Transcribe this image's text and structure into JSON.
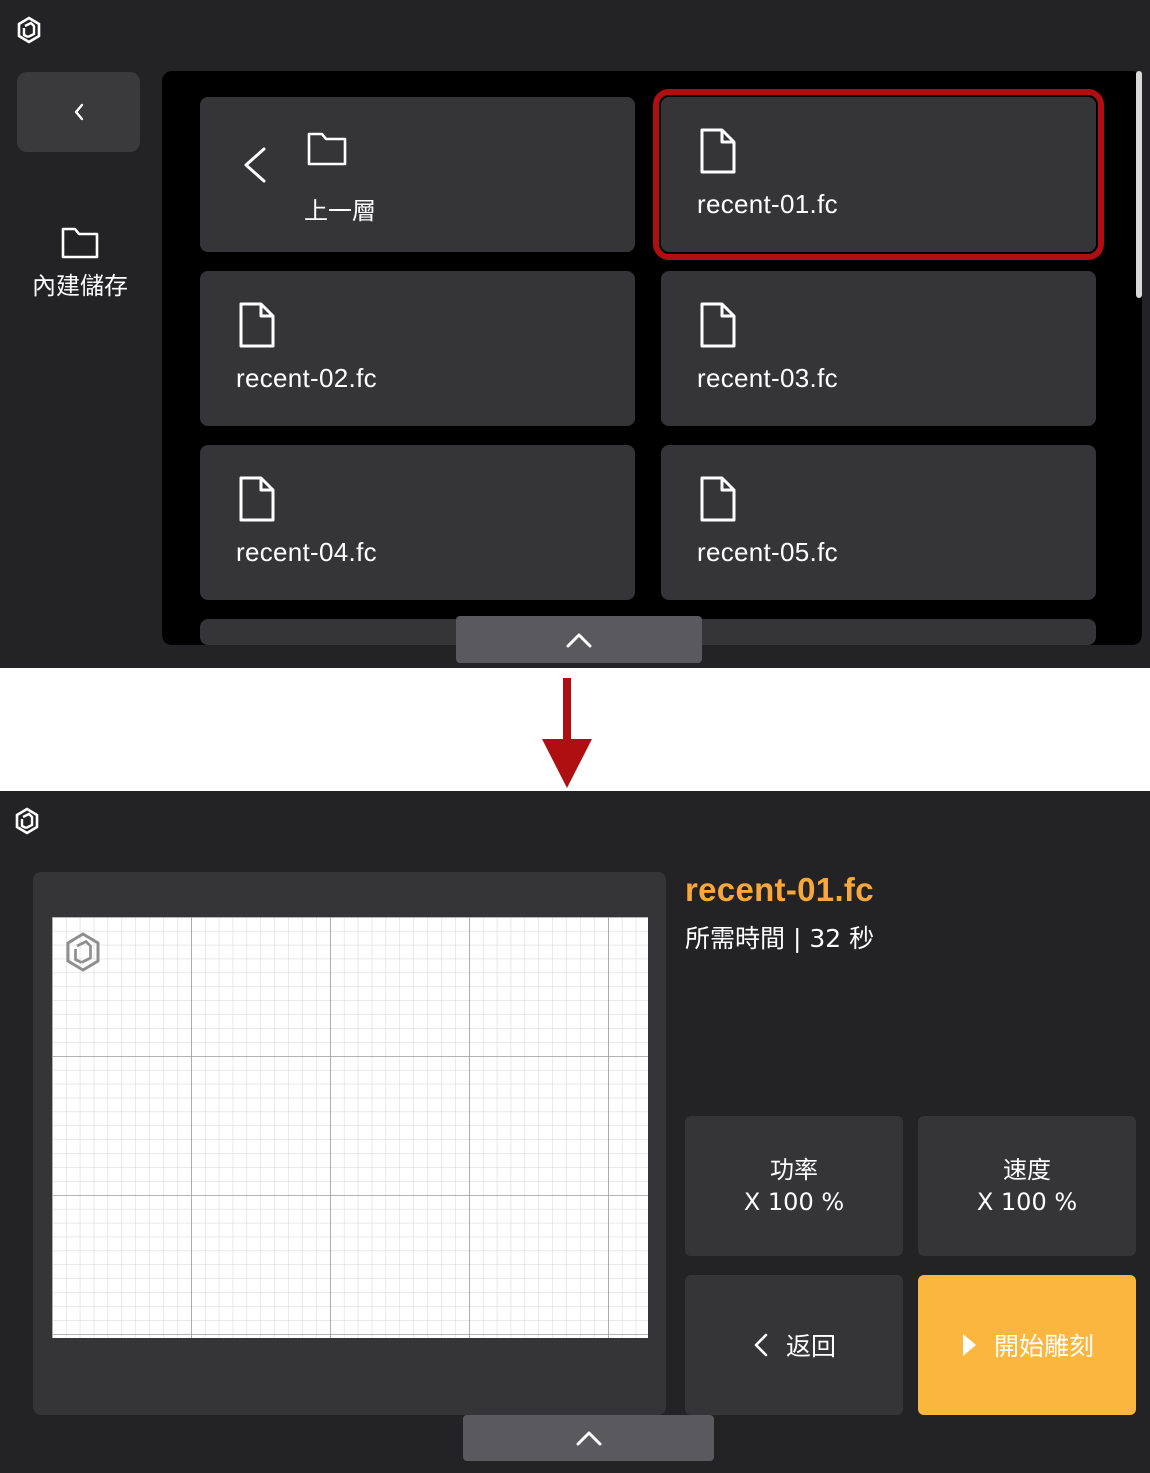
{
  "screen1": {
    "storage_label": "內建儲存",
    "up_one_level_label": "上一層",
    "files": [
      {
        "name": "recent-01.fc",
        "selected": true
      },
      {
        "name": "recent-02.fc",
        "selected": false
      },
      {
        "name": "recent-03.fc",
        "selected": false
      },
      {
        "name": "recent-04.fc",
        "selected": false
      },
      {
        "name": "recent-05.fc",
        "selected": false
      }
    ],
    "icons": [
      "app-logo-icon",
      "chevron-left-icon",
      "folder-icon",
      "file-icon",
      "chevron-up-icon"
    ]
  },
  "screen2": {
    "file_title": "recent-01.fc",
    "time_label": "所需時間 | 32 秒",
    "power": {
      "label": "功率",
      "value": "X 100 %"
    },
    "speed": {
      "label": "速度",
      "value": "X 100 %"
    },
    "return_label": "返回",
    "start_label": "開始雕刻"
  },
  "colors": {
    "background": "#232325",
    "tile": "#353538",
    "file_list_panel": "#000000",
    "selected_outline": "#b00f12",
    "file_title": "#f7a73c",
    "start_button": "#fbb63f",
    "flow_arrow": "#b00f12"
  }
}
